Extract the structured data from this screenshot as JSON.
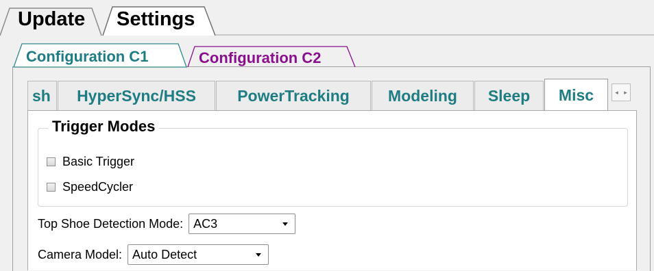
{
  "top_tabs": [
    "Update",
    "Settings"
  ],
  "config_tabs": [
    "Configuration C1",
    "Configuration C2"
  ],
  "colors": {
    "teal": "#1e7c83",
    "purple": "#8a0f8e",
    "border": "#a0a0a0"
  },
  "inner_tabs": [
    "sh",
    "HyperSync/HSS",
    "PowerTracking",
    "Modeling",
    "Sleep",
    "Misc"
  ],
  "active_inner_tab": "Misc",
  "scroll_buttons": {
    "left": "◂",
    "right": "▸"
  },
  "trigger_modes": {
    "title": "Trigger Modes",
    "options": [
      {
        "label": "Basic Trigger",
        "checked": false
      },
      {
        "label": "SpeedCycler",
        "checked": false
      }
    ]
  },
  "top_shoe": {
    "label": "Top Shoe Detection Mode:",
    "value": "AC3"
  },
  "camera_model": {
    "label": "Camera Model:",
    "value": "Auto Detect"
  },
  "icons": {
    "dropdown": "chevron-down-icon"
  }
}
